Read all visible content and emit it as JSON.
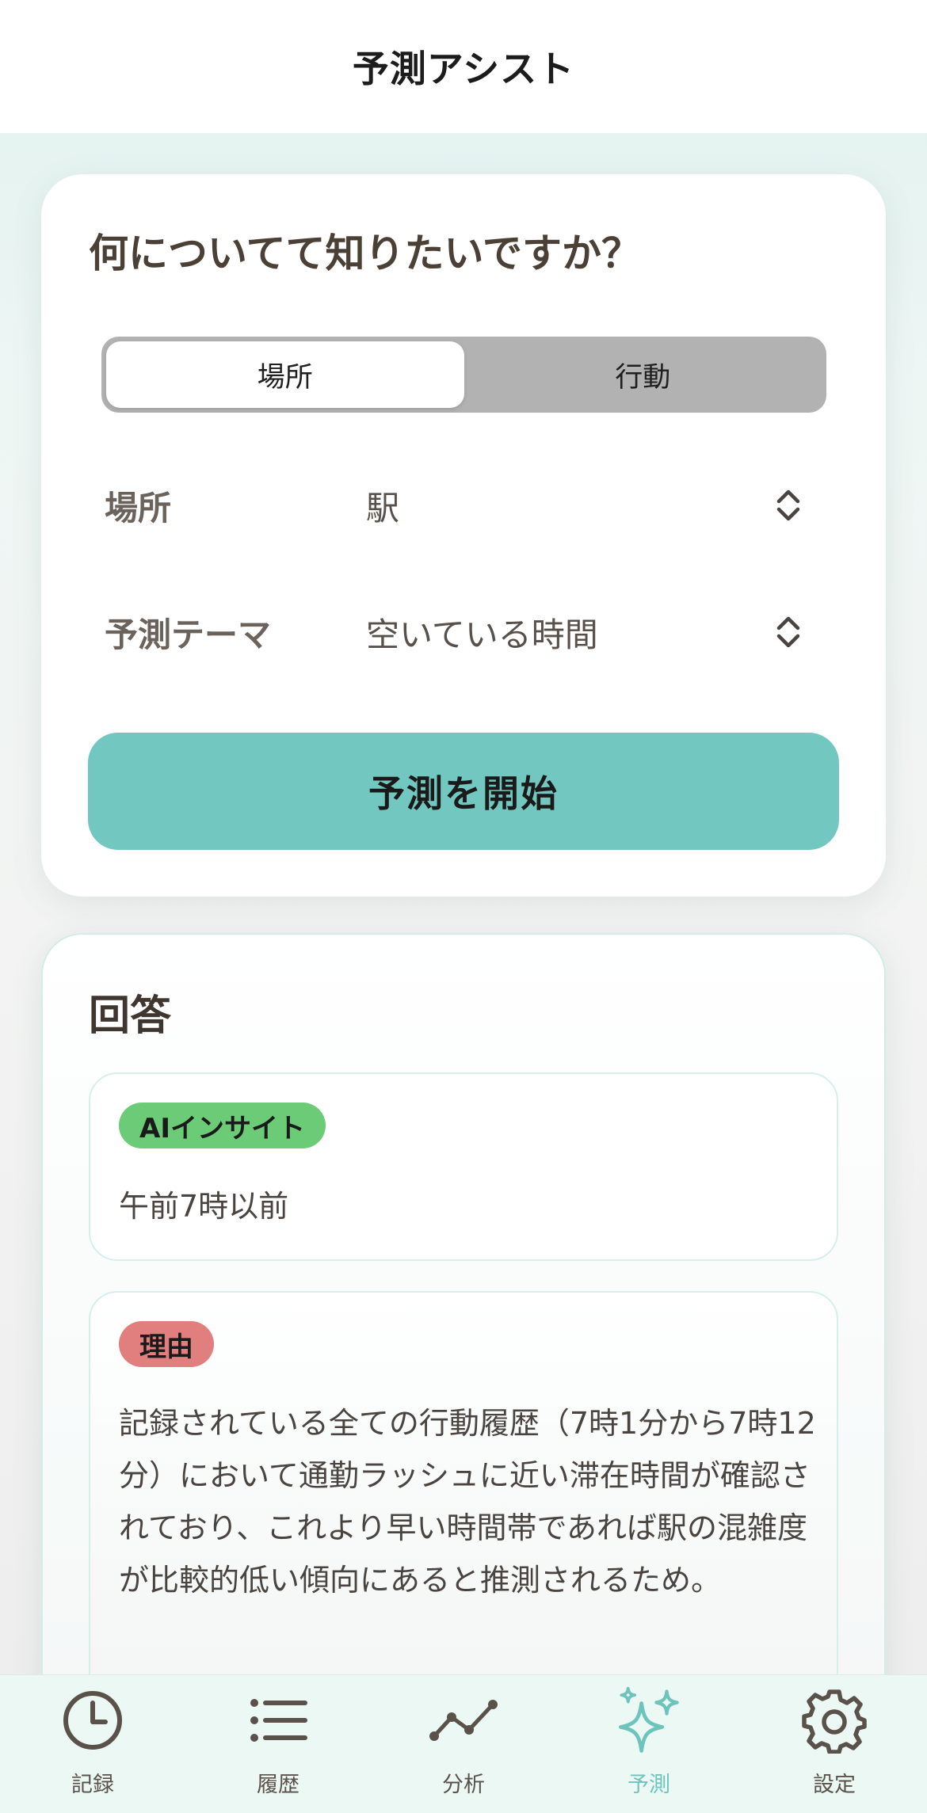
{
  "header": {
    "title": "予測アシスト"
  },
  "question_card": {
    "title": "何についてて知りたいですか？",
    "segments": [
      {
        "label": "場所",
        "selected": true
      },
      {
        "label": "行動",
        "selected": false
      }
    ],
    "place_row": {
      "label": "場所",
      "value": "駅"
    },
    "theme_row": {
      "label": "予測テーマ",
      "value": "空いている時間"
    },
    "start_button": "予測を開始"
  },
  "answer_card": {
    "title": "回答",
    "insight": {
      "badge": "AIインサイト",
      "text": "午前7時以前"
    },
    "reason": {
      "badge": "理由",
      "text": "記録されている全ての行動履歴（7時1分から7時12分）において通勤ラッシュに近い滞在時間が確認されており、これより早い時間帯であれば駅の混雑度が比較的低い傾向にあると推測されるため。"
    }
  },
  "tabbar": {
    "items": [
      {
        "label": "記録",
        "icon": "clock-icon",
        "active": false
      },
      {
        "label": "履歴",
        "icon": "list-icon",
        "active": false
      },
      {
        "label": "分析",
        "icon": "chart-line-icon",
        "active": false
      },
      {
        "label": "予測",
        "icon": "sparkles-icon",
        "active": true
      },
      {
        "label": "設定",
        "icon": "gear-icon",
        "active": false
      }
    ]
  },
  "colors": {
    "accent": "#72c8c0",
    "insight_badge": "#6bcb76",
    "reason_badge": "#e07f7e",
    "active_tab": "#6cc4bd"
  }
}
